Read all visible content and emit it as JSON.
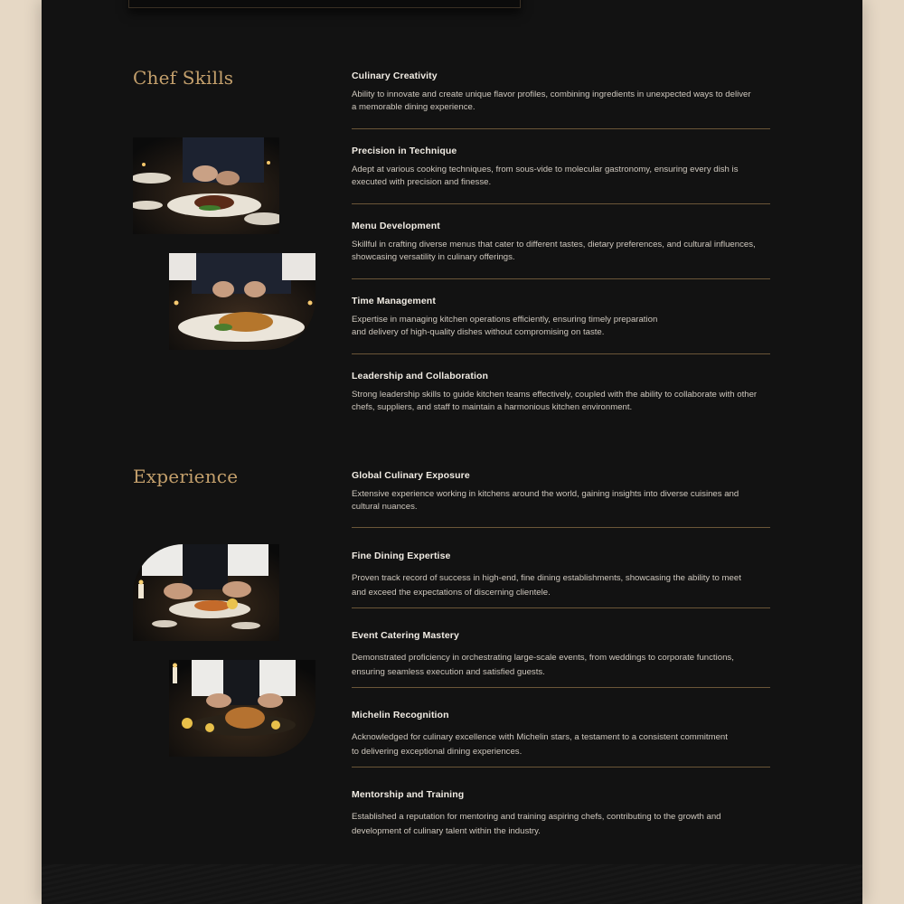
{
  "sections": {
    "skills": {
      "title": "Chef Skills",
      "items": [
        {
          "title": "Culinary Creativity",
          "text": "Ability to innovate and create unique flavor profiles, combining ingredients in unexpected ways to deliver\na memorable dining experience."
        },
        {
          "title": "Precision in Technique",
          "text": "Adept at various cooking techniques, from sous-vide to molecular gastronomy, ensuring every dish is\nexecuted with precision and finesse."
        },
        {
          "title": "Menu Development",
          "text": "Skillful in crafting diverse menus that cater to different tastes, dietary preferences, and cultural influences,\nshowcasing versatility in culinary offerings."
        },
        {
          "title": "Time Management",
          "text": "Expertise in managing kitchen operations efficiently, ensuring timely preparation\nand delivery of high-quality dishes without compromising on taste."
        },
        {
          "title": "Leadership and Collaboration",
          "text": "Strong leadership skills to guide kitchen teams effectively, coupled with the ability to collaborate with other\nchefs, suppliers, and staff to maintain a harmonious kitchen environment."
        }
      ]
    },
    "experience": {
      "title": "Experience",
      "items": [
        {
          "title": "Global Culinary Exposure",
          "text": "Extensive experience working in kitchens around the world, gaining insights into diverse cuisines and\ncultural nuances."
        },
        {
          "title": "Fine Dining Expertise",
          "text": "Proven track record of success in high-end, fine dining establishments, showcasing the ability to meet\nand exceed the expectations of discerning clientele."
        },
        {
          "title": "Event Catering Mastery",
          "text": "Demonstrated proficiency in orchestrating large-scale events, from weddings to corporate functions,\nensuring seamless execution and satisfied guests."
        },
        {
          "title": "Michelin Recognition",
          "text": "Acknowledged for culinary excellence with Michelin stars, a testament to a consistent commitment\nto delivering exceptional dining experiences."
        },
        {
          "title": "Mentorship and Training",
          "text": "Established a reputation for mentoring and training aspiring chefs, contributing to the growth and\ndevelopment of culinary talent within the industry."
        }
      ]
    }
  },
  "colors": {
    "background": "#121212",
    "outer": "#e6d8c5",
    "accent_gold": "#c4a06c",
    "divider": "#6b5638",
    "heading_text": "#f1ece4",
    "body_text": "#cfc8be"
  },
  "images": [
    "chef-plating-steak-photo",
    "chef-plating-roast-photo",
    "chef-garnishing-dish-photo",
    "chef-carving-roast-photo"
  ]
}
